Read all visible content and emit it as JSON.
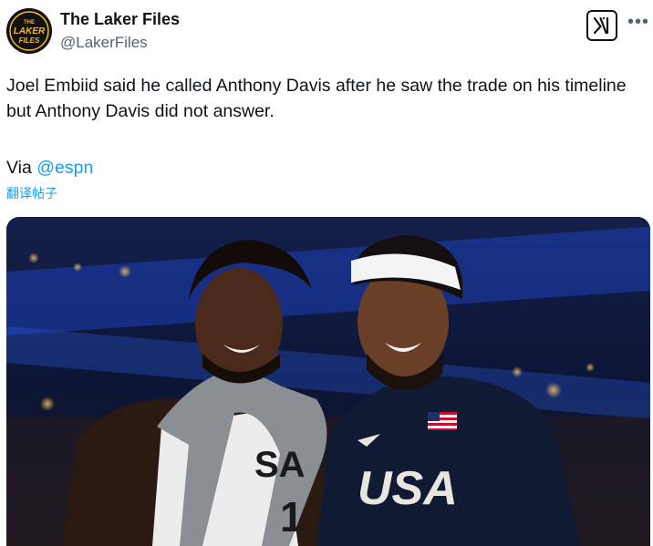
{
  "author": {
    "name": "The Laker Files",
    "handle": "@LakerFiles",
    "avatar_text": [
      "THE",
      "LAKER",
      "FILES"
    ]
  },
  "tweet": {
    "text": "Joel Embiid said he called Anthony Davis after he saw the trade on his timeline but Anthony Davis did not answer.",
    "via_label": "Via",
    "via_mention": "@espn",
    "translate_label": "翻译帖子"
  },
  "photo": {
    "jersey_left": "SA",
    "jersey_left_number": "1",
    "jersey_right": "USA"
  },
  "icons": {
    "x_logo": "x-logo-icon",
    "more": "more-options-icon"
  },
  "colors": {
    "link": "#1d9bf0",
    "muted": "#536471",
    "avatar_gold": "#f5b82e"
  }
}
